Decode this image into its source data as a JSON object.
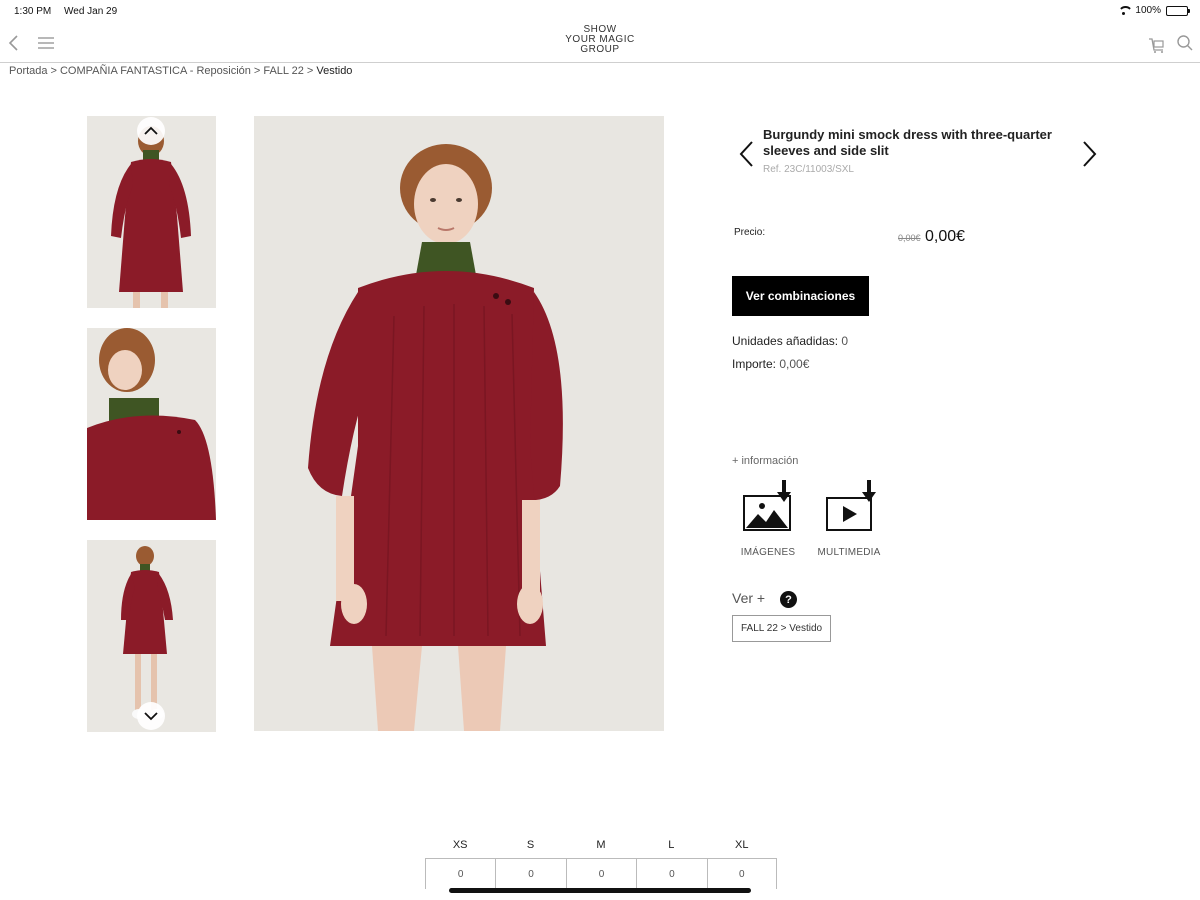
{
  "status_bar": {
    "time": "1:30 PM",
    "date": "Wed Jan 29",
    "battery": "100%"
  },
  "nav": {
    "logo_lines": [
      "SHOW",
      "YOUR MAGIC",
      "GROUP"
    ],
    "icons": [
      "back-arrow-icon",
      "hamburger-menu-icon",
      "shopping-bag-icon",
      "search-icon"
    ]
  },
  "breadcrumb": {
    "items": [
      "Portada",
      "COMPAÑIA FANTASTICA - Reposición",
      "FALL 22"
    ],
    "current": "Vestido",
    "separator": ">"
  },
  "gallery": {
    "thumbnails": [
      "thumb-back-view",
      "thumb-detail-view",
      "thumb-full-view"
    ],
    "colors": {
      "dress": "#8b1b28",
      "turtleneck": "#3f5523",
      "background": "#e8e6e1"
    }
  },
  "product": {
    "title": "Burgundy mini smock dress with three-quarter sleeves and side slit",
    "ref": "Ref. 23C/11003/SXL",
    "price_label": "Precio:",
    "price_old": "0,00€",
    "price_current": "0,00€",
    "combos_button": "Ver combinaciones",
    "units_label": "Unidades añadidas:",
    "units_value": "0",
    "amount_label": "Importe:",
    "amount_value": "0,00€",
    "more_info": "+ información",
    "media": {
      "images_label": "IMÁGENES",
      "multimedia_label": "MULTIMEDIA"
    },
    "ver_more": "Ver +",
    "tag": "FALL 22 > Vestido"
  },
  "sizes": {
    "headers": [
      "XS",
      "S",
      "M",
      "L",
      "XL"
    ],
    "values": [
      "0",
      "0",
      "0",
      "0",
      "0"
    ]
  }
}
